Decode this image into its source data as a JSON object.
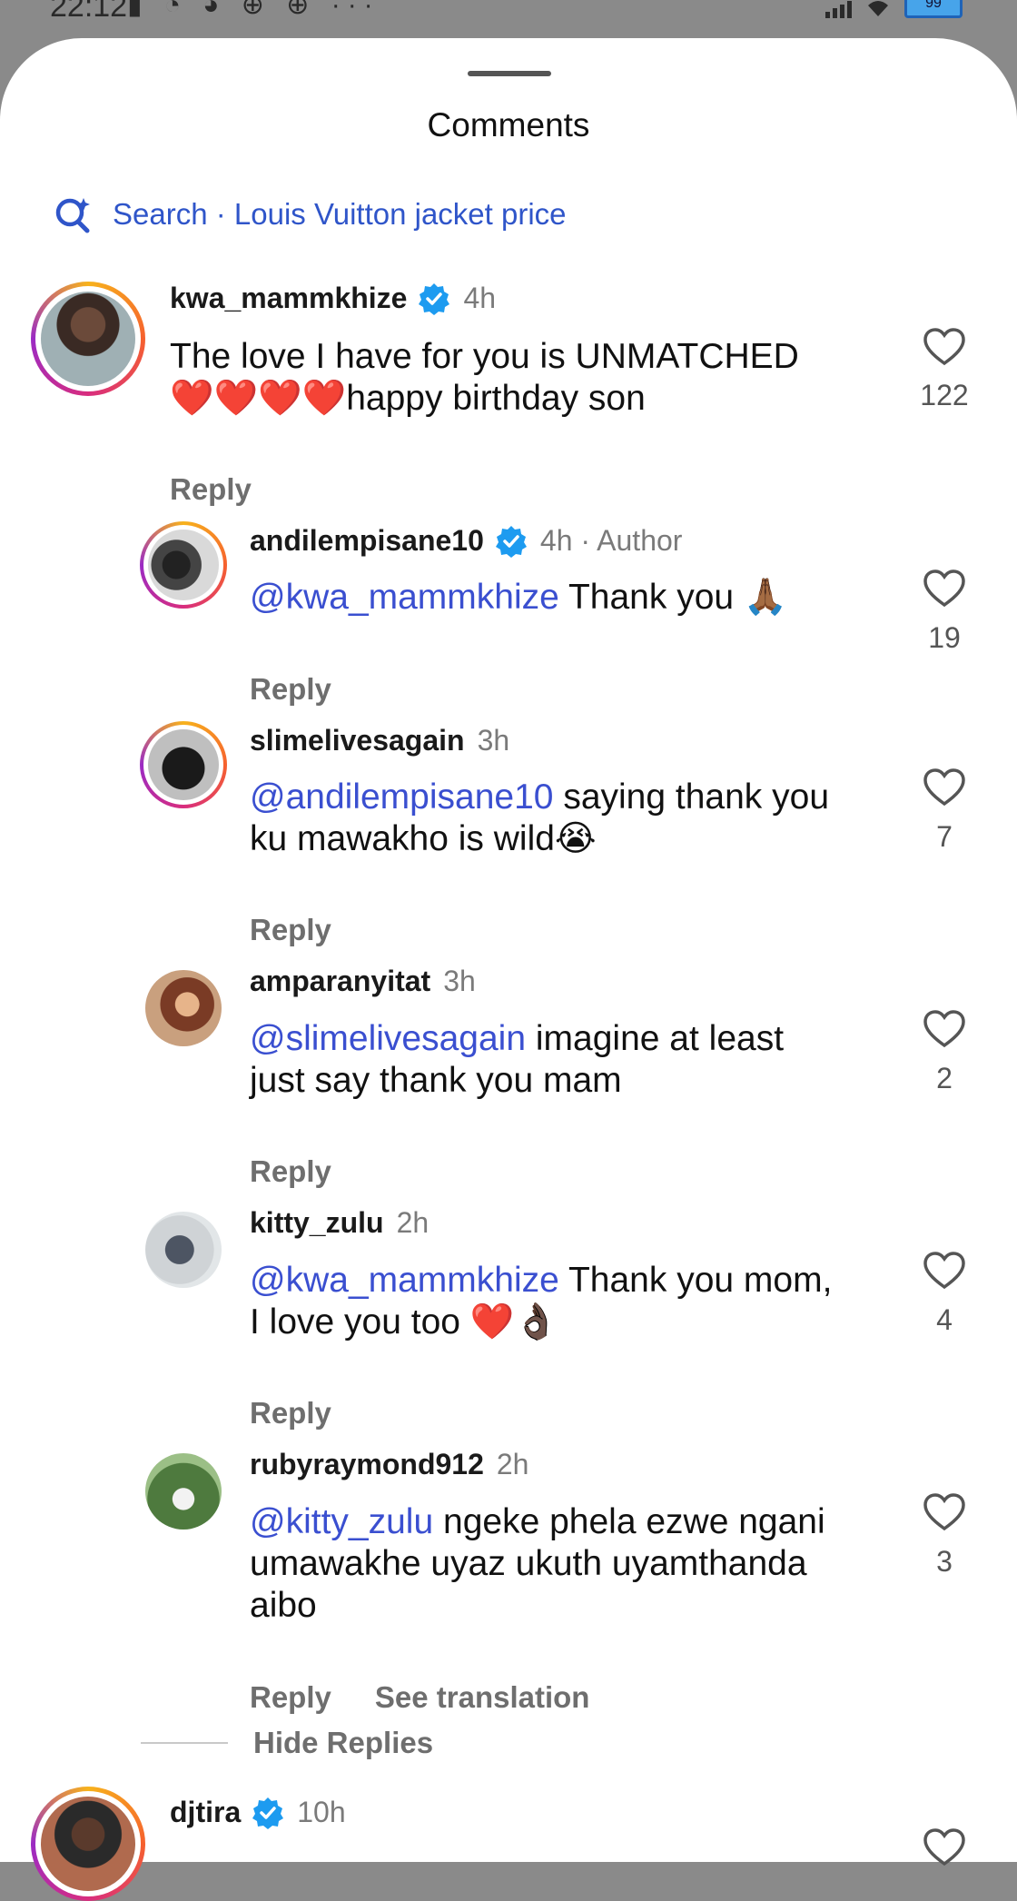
{
  "status_bar": {
    "time": "22:12",
    "battery": "99"
  },
  "sheet": {
    "title": "Comments"
  },
  "search": {
    "label": "Search · Louis Vuitton jacket price"
  },
  "comments": [
    {
      "username": "kwa_mammkhize",
      "verified": true,
      "time": "4h",
      "mention": "",
      "text_line1": "The love I have for you is UNMATCHED",
      "text_line2": "❤️❤️❤️❤️happy birthday son",
      "text_line3": "",
      "reply": "Reply",
      "likes": "122"
    },
    {
      "username": "andilempisane10",
      "verified": true,
      "time": "4h · Author",
      "mention": "@kwa_mammkhize",
      "text_line1": " Thank you 🙏🏾",
      "text_line2": "",
      "text_line3": "",
      "reply": "Reply",
      "likes": "19"
    },
    {
      "username": "slimelivesagain",
      "verified": false,
      "time": "3h",
      "mention": "@andilempisane10",
      "text_line1": " saying thank you",
      "text_line2": "ku mawakho is wild😭",
      "text_line3": "",
      "reply": "Reply",
      "likes": "7"
    },
    {
      "username": "amparanyitat",
      "verified": false,
      "time": "3h",
      "mention": "@slimelivesagain",
      "text_line1": " imagine at least",
      "text_line2": "just say thank you mam",
      "text_line3": "",
      "reply": "Reply",
      "likes": "2"
    },
    {
      "username": "kitty_zulu",
      "verified": false,
      "time": "2h",
      "mention": "@kwa_mammkhize",
      "text_line1": " Thank you mom,",
      "text_line2": "I love you too ❤️👌🏿",
      "text_line3": "",
      "reply": "Reply",
      "likes": "4"
    },
    {
      "username": "rubyraymond912",
      "verified": false,
      "time": "2h",
      "mention": "@kitty_zulu",
      "text_line1": " ngeke phela ezwe ngani",
      "text_line2": "umawakhe uyaz ukuth uyamthanda",
      "text_line3": "aibo",
      "reply": "Reply",
      "see_translation": "See translation",
      "likes": "3"
    },
    {
      "username": "djtira",
      "verified": true,
      "time": "10h"
    }
  ],
  "hide_replies": "Hide Replies",
  "colors": {
    "mention": "#3a4fd0",
    "verified": "#1d9bf0",
    "search": "#2f55c9"
  }
}
